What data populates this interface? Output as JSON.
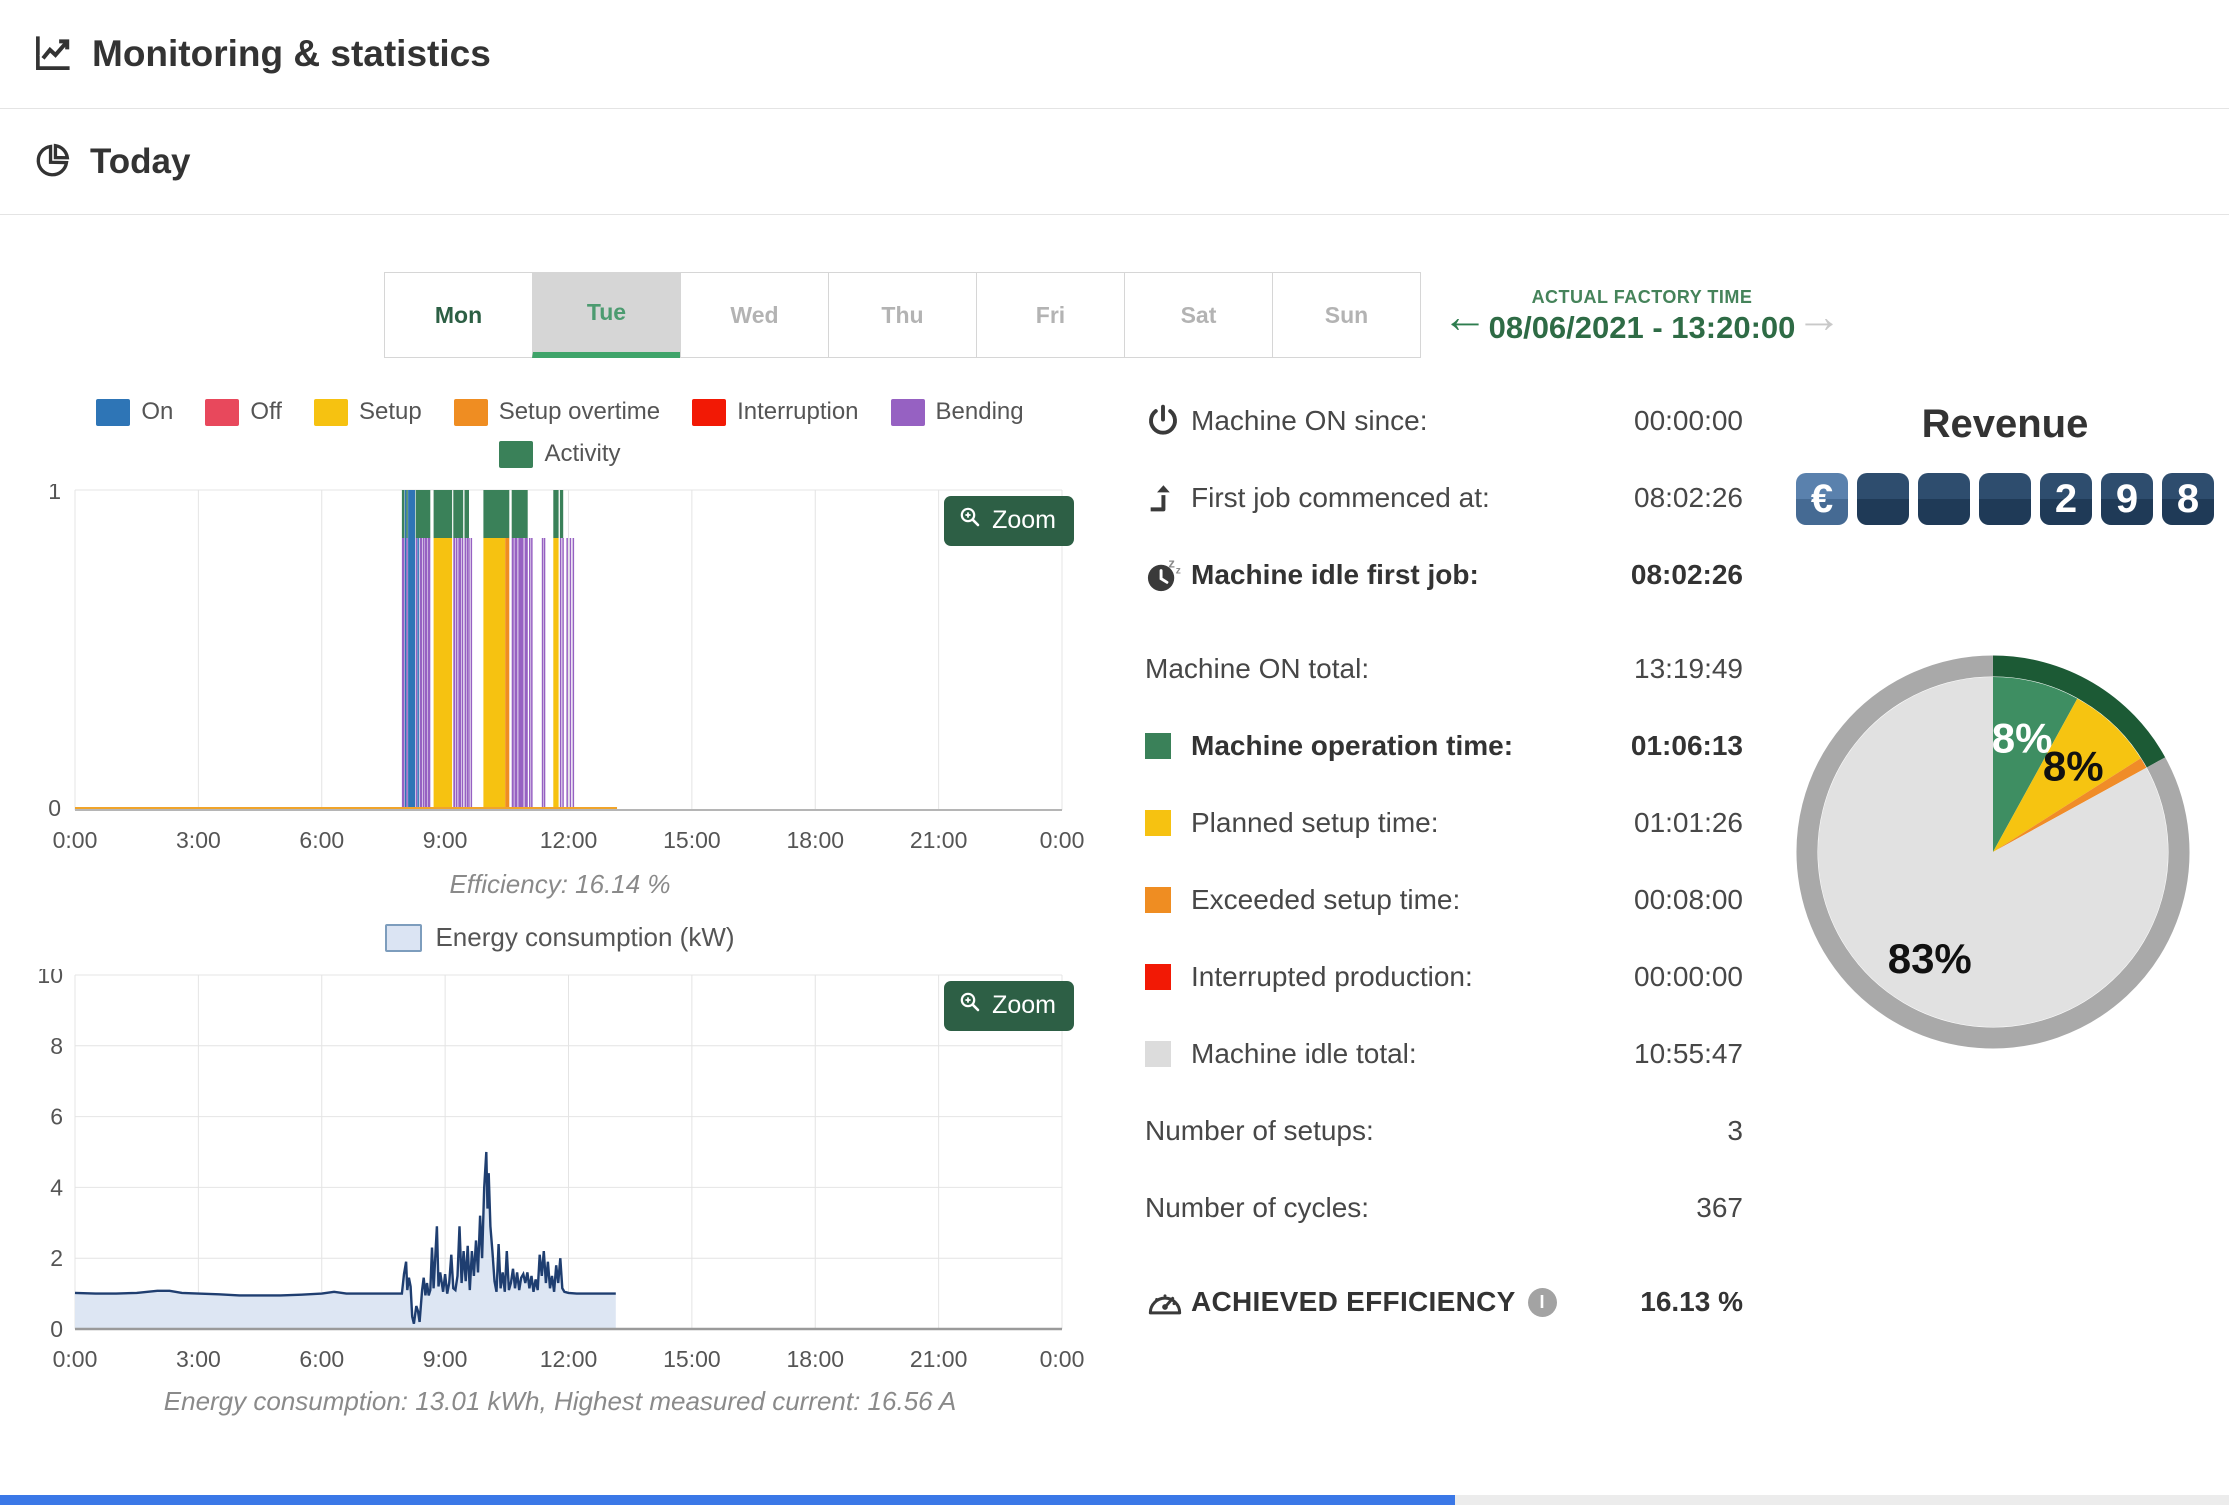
{
  "header": {
    "title": "Monitoring & statistics"
  },
  "subheader": {
    "title": "Today"
  },
  "day_tabs": {
    "days": [
      {
        "label": "Mon",
        "state": "past"
      },
      {
        "label": "Tue",
        "state": "active"
      },
      {
        "label": "Wed",
        "state": "future"
      },
      {
        "label": "Thu",
        "state": "future"
      },
      {
        "label": "Fri",
        "state": "future"
      },
      {
        "label": "Sat",
        "state": "future"
      },
      {
        "label": "Sun",
        "state": "future"
      }
    ]
  },
  "factory_time": {
    "label": "ACTUAL FACTORY TIME",
    "value": "08/06/2021 - 13:20:00"
  },
  "stats": {
    "rows": [
      {
        "icon": "power",
        "label": "Machine ON since:",
        "value": "00:00:00"
      },
      {
        "icon": "first-job",
        "label": "First job commenced at:",
        "value": "08:02:26"
      },
      {
        "icon": "idle",
        "label": "Machine idle first job:",
        "value": "08:02:26",
        "bold": true
      },
      {
        "label": "Machine ON total:",
        "value": "13:19:49",
        "gap_before": true
      },
      {
        "swatch": "#3a8159",
        "label": "Machine operation time:",
        "value": "01:06:13",
        "bold": true
      },
      {
        "swatch": "#f6c211",
        "label": "Planned setup time:",
        "value": "01:01:26"
      },
      {
        "swatch": "#ef8d22",
        "label": "Exceeded setup time:",
        "value": "00:08:00"
      },
      {
        "swatch": "#f21905",
        "label": "Interrupted production:",
        "value": "00:00:00"
      },
      {
        "swatch": "#dcdcdc",
        "label": "Machine idle total:",
        "value": "10:55:47"
      },
      {
        "label": "Number of setups:",
        "value": "3"
      },
      {
        "label": "Number of cycles:",
        "value": "367"
      },
      {
        "icon": "gauge",
        "label": "Achieved efficiency",
        "value": "16.13 %",
        "bold": true,
        "caps": true,
        "info": true,
        "gap_before": true
      }
    ]
  },
  "revenue": {
    "title": "Revenue",
    "cells": [
      {
        "text": "€",
        "type": "currency"
      },
      {
        "text": ""
      },
      {
        "text": ""
      },
      {
        "text": ""
      },
      {
        "text": "2"
      },
      {
        "text": "9"
      },
      {
        "text": "8"
      }
    ]
  },
  "chart_data": [
    {
      "id": "machine-status",
      "type": "bar",
      "zoom_label": "Zoom",
      "caption": "Efficiency: 16.14 %",
      "x_ticks": [
        "0:00",
        "3:00",
        "6:00",
        "9:00",
        "12:00",
        "15:00",
        "18:00",
        "21:00",
        "0:00"
      ],
      "x_range_hours": [
        0,
        24
      ],
      "ylim": [
        0,
        1
      ],
      "y_ticks": [
        "1",
        "0"
      ],
      "legend": [
        {
          "label": "On",
          "color": "#2e75b6"
        },
        {
          "label": "Off",
          "color": "#e8485c"
        },
        {
          "label": "Setup",
          "color": "#f6c211"
        },
        {
          "label": "Setup overtime",
          "color": "#ef8d22"
        },
        {
          "label": "Interruption",
          "color": "#f21905"
        },
        {
          "label": "Bending",
          "color": "#9661c2"
        }
      ],
      "legend_row2": [
        {
          "label": "Activity",
          "color": "#3a8159"
        }
      ],
      "colors": {
        "on": "#2e75b6",
        "off": "#e8485c",
        "setup": "#f6c211",
        "setup_overtime": "#ef8d22",
        "interruption": "#f21905",
        "bending": "#9661c2",
        "activity": "#3a8159",
        "baseline": "#f0a42a"
      },
      "body_top_fraction": 0.15,
      "baseline_span_hours": [
        0,
        13.18
      ],
      "stripes": [
        [
          7.95,
          8.01,
          "bending"
        ],
        [
          8.02,
          8.045,
          "on"
        ],
        [
          8.055,
          8.08,
          "bending"
        ],
        [
          8.1,
          8.27,
          "on"
        ],
        [
          8.285,
          8.315,
          "bending"
        ],
        [
          8.325,
          8.35,
          "on"
        ],
        [
          8.38,
          8.44,
          "bending"
        ],
        [
          8.455,
          8.49,
          "bending"
        ],
        [
          8.5,
          8.56,
          "bending"
        ],
        [
          8.575,
          8.64,
          "bending"
        ],
        [
          8.72,
          9.17,
          "setup"
        ],
        [
          9.2,
          9.25,
          "bending"
        ],
        [
          9.265,
          9.3,
          "bending"
        ],
        [
          9.32,
          9.39,
          "bending"
        ],
        [
          9.405,
          9.44,
          "bending"
        ],
        [
          9.47,
          9.5,
          "bending"
        ],
        [
          9.52,
          9.545,
          "bending"
        ],
        [
          9.56,
          9.58,
          "bending"
        ],
        [
          9.62,
          9.64,
          "bending"
        ],
        [
          9.93,
          10.46,
          "setup"
        ],
        [
          10.46,
          10.56,
          "setup_overtime"
        ],
        [
          10.62,
          10.67,
          "bending"
        ],
        [
          10.685,
          10.76,
          "bending"
        ],
        [
          10.78,
          10.91,
          "bending"
        ],
        [
          10.93,
          11.01,
          "bending"
        ],
        [
          11.04,
          11.07,
          "bending"
        ],
        [
          11.09,
          11.115,
          "bending"
        ],
        [
          11.35,
          11.38,
          "bending"
        ],
        [
          11.4,
          11.425,
          "bending"
        ],
        [
          11.63,
          11.76,
          "setup"
        ],
        [
          11.79,
          11.81,
          "bending"
        ],
        [
          11.85,
          11.87,
          "bending"
        ],
        [
          11.95,
          11.97,
          "bending"
        ],
        [
          12.03,
          12.05,
          "bending"
        ],
        [
          12.1,
          12.12,
          "bending"
        ]
      ],
      "activity_caps": [
        [
          7.95,
          8.01
        ],
        [
          8.055,
          8.08
        ],
        [
          8.285,
          8.64
        ],
        [
          8.72,
          9.17
        ],
        [
          9.2,
          9.44
        ],
        [
          9.47,
          9.58
        ],
        [
          9.93,
          10.56
        ],
        [
          10.62,
          11.01
        ],
        [
          11.63,
          11.76
        ],
        [
          11.79,
          11.87
        ]
      ]
    },
    {
      "id": "energy-consumption",
      "type": "area",
      "legend_label": "Energy consumption (kW)",
      "zoom_label": "Zoom",
      "caption": "Energy consumption: 13.01 kWh, Highest measured current: 16.56 A",
      "x_ticks": [
        "0:00",
        "3:00",
        "6:00",
        "9:00",
        "12:00",
        "15:00",
        "18:00",
        "21:00",
        "0:00"
      ],
      "x_range_hours": [
        0,
        24
      ],
      "ylim": [
        0,
        10
      ],
      "y_ticks": [
        0,
        2,
        4,
        6,
        8,
        10
      ],
      "line_color": "#1f3e70",
      "fill_color": "#dde6f3",
      "points": [
        [
          0,
          1.02
        ],
        [
          0.5,
          1.0
        ],
        [
          1,
          1.0
        ],
        [
          1.5,
          1.02
        ],
        [
          2,
          1.08
        ],
        [
          2.3,
          1.08
        ],
        [
          2.6,
          1.02
        ],
        [
          3,
          1.0
        ],
        [
          3.5,
          0.98
        ],
        [
          4,
          0.95
        ],
        [
          4.5,
          0.95
        ],
        [
          5,
          0.95
        ],
        [
          5.5,
          0.97
        ],
        [
          6,
          1.0
        ],
        [
          6.3,
          1.05
        ],
        [
          6.6,
          1.0
        ],
        [
          7,
          1.0
        ],
        [
          7.5,
          1.0
        ],
        [
          7.95,
          1.0
        ],
        [
          8.0,
          1.55
        ],
        [
          8.05,
          1.9
        ],
        [
          8.08,
          1.1
        ],
        [
          8.12,
          1.45
        ],
        [
          8.16,
          1.2
        ],
        [
          8.2,
          0.35
        ],
        [
          8.24,
          0.15
        ],
        [
          8.3,
          0.65
        ],
        [
          8.34,
          0.5
        ],
        [
          8.38,
          0.2
        ],
        [
          8.44,
          1.1
        ],
        [
          8.48,
          1.45
        ],
        [
          8.52,
          0.95
        ],
        [
          8.56,
          1.3
        ],
        [
          8.6,
          0.95
        ],
        [
          8.64,
          1.1
        ],
        [
          8.68,
          2.3
        ],
        [
          8.72,
          1.15
        ],
        [
          8.76,
          2.05
        ],
        [
          8.8,
          2.9
        ],
        [
          8.84,
          1.2
        ],
        [
          8.88,
          1.6
        ],
        [
          8.95,
          1.05
        ],
        [
          9.0,
          1.55
        ],
        [
          9.05,
          1.0
        ],
        [
          9.1,
          1.3
        ],
        [
          9.15,
          2.1
        ],
        [
          9.2,
          1.15
        ],
        [
          9.25,
          1.1
        ],
        [
          9.3,
          1.5
        ],
        [
          9.35,
          2.9
        ],
        [
          9.4,
          1.3
        ],
        [
          9.45,
          2.2
        ],
        [
          9.5,
          1.35
        ],
        [
          9.55,
          2.35
        ],
        [
          9.6,
          1.1
        ],
        [
          9.65,
          2.2
        ],
        [
          9.7,
          1.5
        ],
        [
          9.75,
          2.5
        ],
        [
          9.8,
          1.6
        ],
        [
          9.85,
          3.2
        ],
        [
          9.9,
          2.0
        ],
        [
          9.95,
          4.0
        ],
        [
          10.0,
          5.0
        ],
        [
          10.03,
          3.4
        ],
        [
          10.06,
          4.4
        ],
        [
          10.1,
          2.9
        ],
        [
          10.15,
          2.2
        ],
        [
          10.2,
          1.35
        ],
        [
          10.25,
          1.05
        ],
        [
          10.3,
          2.4
        ],
        [
          10.35,
          1.15
        ],
        [
          10.4,
          1.6
        ],
        [
          10.45,
          1.05
        ],
        [
          10.5,
          2.2
        ],
        [
          10.55,
          1.1
        ],
        [
          10.6,
          1.3
        ],
        [
          10.65,
          1.7
        ],
        [
          10.7,
          1.15
        ],
        [
          10.75,
          1.6
        ],
        [
          10.8,
          1.1
        ],
        [
          10.85,
          1.45
        ],
        [
          10.9,
          1.55
        ],
        [
          10.95,
          1.3
        ],
        [
          11.0,
          1.6
        ],
        [
          11.05,
          1.15
        ],
        [
          11.1,
          1.5
        ],
        [
          11.15,
          1.05
        ],
        [
          11.2,
          1.4
        ],
        [
          11.25,
          1.1
        ],
        [
          11.3,
          2.1
        ],
        [
          11.35,
          1.5
        ],
        [
          11.4,
          2.2
        ],
        [
          11.45,
          1.3
        ],
        [
          11.5,
          1.9
        ],
        [
          11.55,
          1.15
        ],
        [
          11.6,
          1.5
        ],
        [
          11.65,
          1.05
        ],
        [
          11.7,
          1.8
        ],
        [
          11.75,
          1.3
        ],
        [
          11.8,
          2.0
        ],
        [
          11.85,
          1.15
        ],
        [
          11.9,
          1.05
        ],
        [
          12.0,
          1.02
        ],
        [
          12.2,
          1.0
        ],
        [
          12.6,
          1.0
        ],
        [
          13.0,
          1.0
        ],
        [
          13.15,
          1.0
        ]
      ]
    },
    {
      "id": "time-distribution-pie",
      "type": "pie",
      "segments": [
        {
          "label": "8%",
          "value": 8,
          "color": "#3e8e62",
          "label_color": "#ffffff",
          "label_r": 0.67
        },
        {
          "label": "8%",
          "value": 8,
          "color": "#f6c411",
          "label_color": "#111111",
          "label_r": 0.67
        },
        {
          "label": "",
          "value": 1,
          "color": "#f08c28"
        },
        {
          "label": "83%",
          "value": 83,
          "color": "#e1e1e1",
          "label_color": "#111111",
          "label_r": 0.71
        }
      ],
      "ring": {
        "green_pct": 17,
        "green_color": "#1c5a35",
        "gray_color": "#a9a9a9"
      }
    }
  ]
}
